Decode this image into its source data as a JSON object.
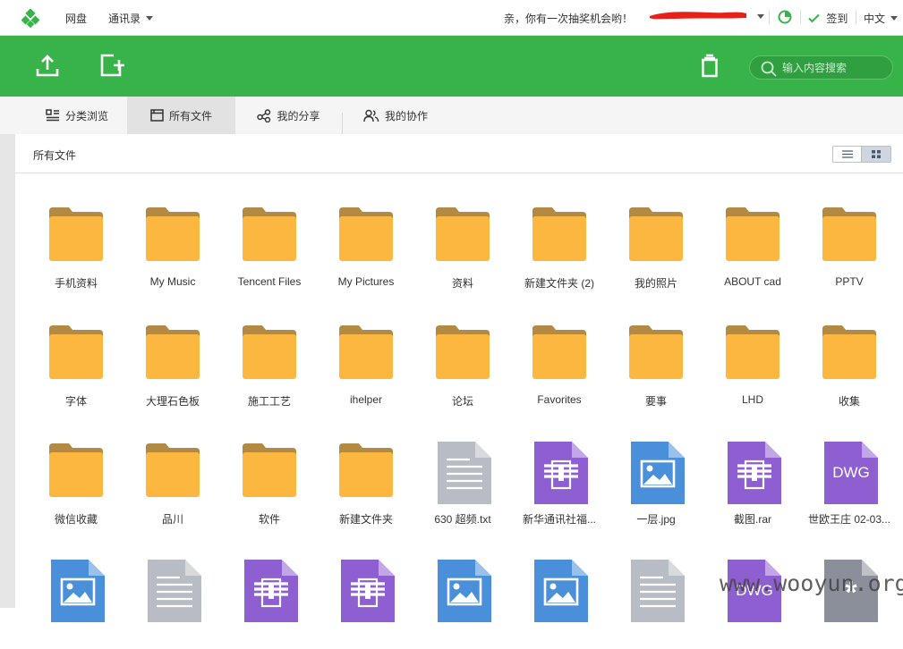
{
  "topbar": {
    "nav": [
      {
        "label": "网盘"
      },
      {
        "label": "通讯录"
      }
    ],
    "lottery": "亲，你有一次抽奖机会哟！",
    "checkin": "签到",
    "language": "中文"
  },
  "toolbar": {
    "search_placeholder": "输入内容搜索"
  },
  "tabs": [
    {
      "label": "分类浏览",
      "icon": "category-icon"
    },
    {
      "label": "所有文件",
      "icon": "all-files-icon",
      "active": true
    },
    {
      "label": "我的分享",
      "icon": "share-icon"
    },
    {
      "label": "我的协作",
      "icon": "collaboration-icon"
    }
  ],
  "breadcrumb": "所有文件",
  "view": {
    "mode": "grid"
  },
  "files": [
    {
      "name": "手机资料",
      "type": "folder"
    },
    {
      "name": "My Music",
      "type": "folder"
    },
    {
      "name": "Tencent Files",
      "type": "folder"
    },
    {
      "name": "My Pictures",
      "type": "folder"
    },
    {
      "name": "资料",
      "type": "folder"
    },
    {
      "name": "新建文件夹 (2)",
      "type": "folder"
    },
    {
      "name": "我的照片",
      "type": "folder"
    },
    {
      "name": "ABOUT cad",
      "type": "folder"
    },
    {
      "name": "PPTV",
      "type": "folder"
    },
    {
      "name": "字体",
      "type": "folder"
    },
    {
      "name": "大理石色板",
      "type": "folder"
    },
    {
      "name": "施工工艺",
      "type": "folder"
    },
    {
      "name": "ihelper",
      "type": "folder"
    },
    {
      "name": "论坛",
      "type": "folder"
    },
    {
      "name": "Favorites",
      "type": "folder"
    },
    {
      "name": "要事",
      "type": "folder"
    },
    {
      "name": "LHD",
      "type": "folder"
    },
    {
      "name": "收集",
      "type": "folder"
    },
    {
      "name": "微信收藏",
      "type": "folder"
    },
    {
      "name": "品川",
      "type": "folder"
    },
    {
      "name": "软件",
      "type": "folder"
    },
    {
      "name": "新建文件夹",
      "type": "folder"
    },
    {
      "name": "630 超频.txt",
      "type": "txt"
    },
    {
      "name": "新华通讯社福...",
      "type": "rar"
    },
    {
      "name": "一层.jpg",
      "type": "jpg"
    },
    {
      "name": "截图.rar",
      "type": "rar"
    },
    {
      "name": "世欧王庄 02-03...",
      "type": "dwg",
      "badge": "DWG"
    },
    {
      "name": "",
      "type": "jpg"
    },
    {
      "name": "",
      "type": "txt"
    },
    {
      "name": "",
      "type": "rar"
    },
    {
      "name": "",
      "type": "rar"
    },
    {
      "name": "",
      "type": "jpg"
    },
    {
      "name": "",
      "type": "jpg"
    },
    {
      "name": "",
      "type": "txt"
    },
    {
      "name": "",
      "type": "dwg",
      "badge": "DWG"
    },
    {
      "name": "",
      "type": "other",
      "badge": "*"
    }
  ],
  "colors": {
    "brand_green": "#37b34a",
    "folder_body": "#fbb73f",
    "folder_tab": "#b28a43",
    "txt": "#b8bcc4",
    "rar": "#8e5fd1",
    "jpg": "#4a8fd9",
    "dwg": "#8e5fd1",
    "other": "#8a8f99"
  },
  "watermark": "www.wooyun.org"
}
